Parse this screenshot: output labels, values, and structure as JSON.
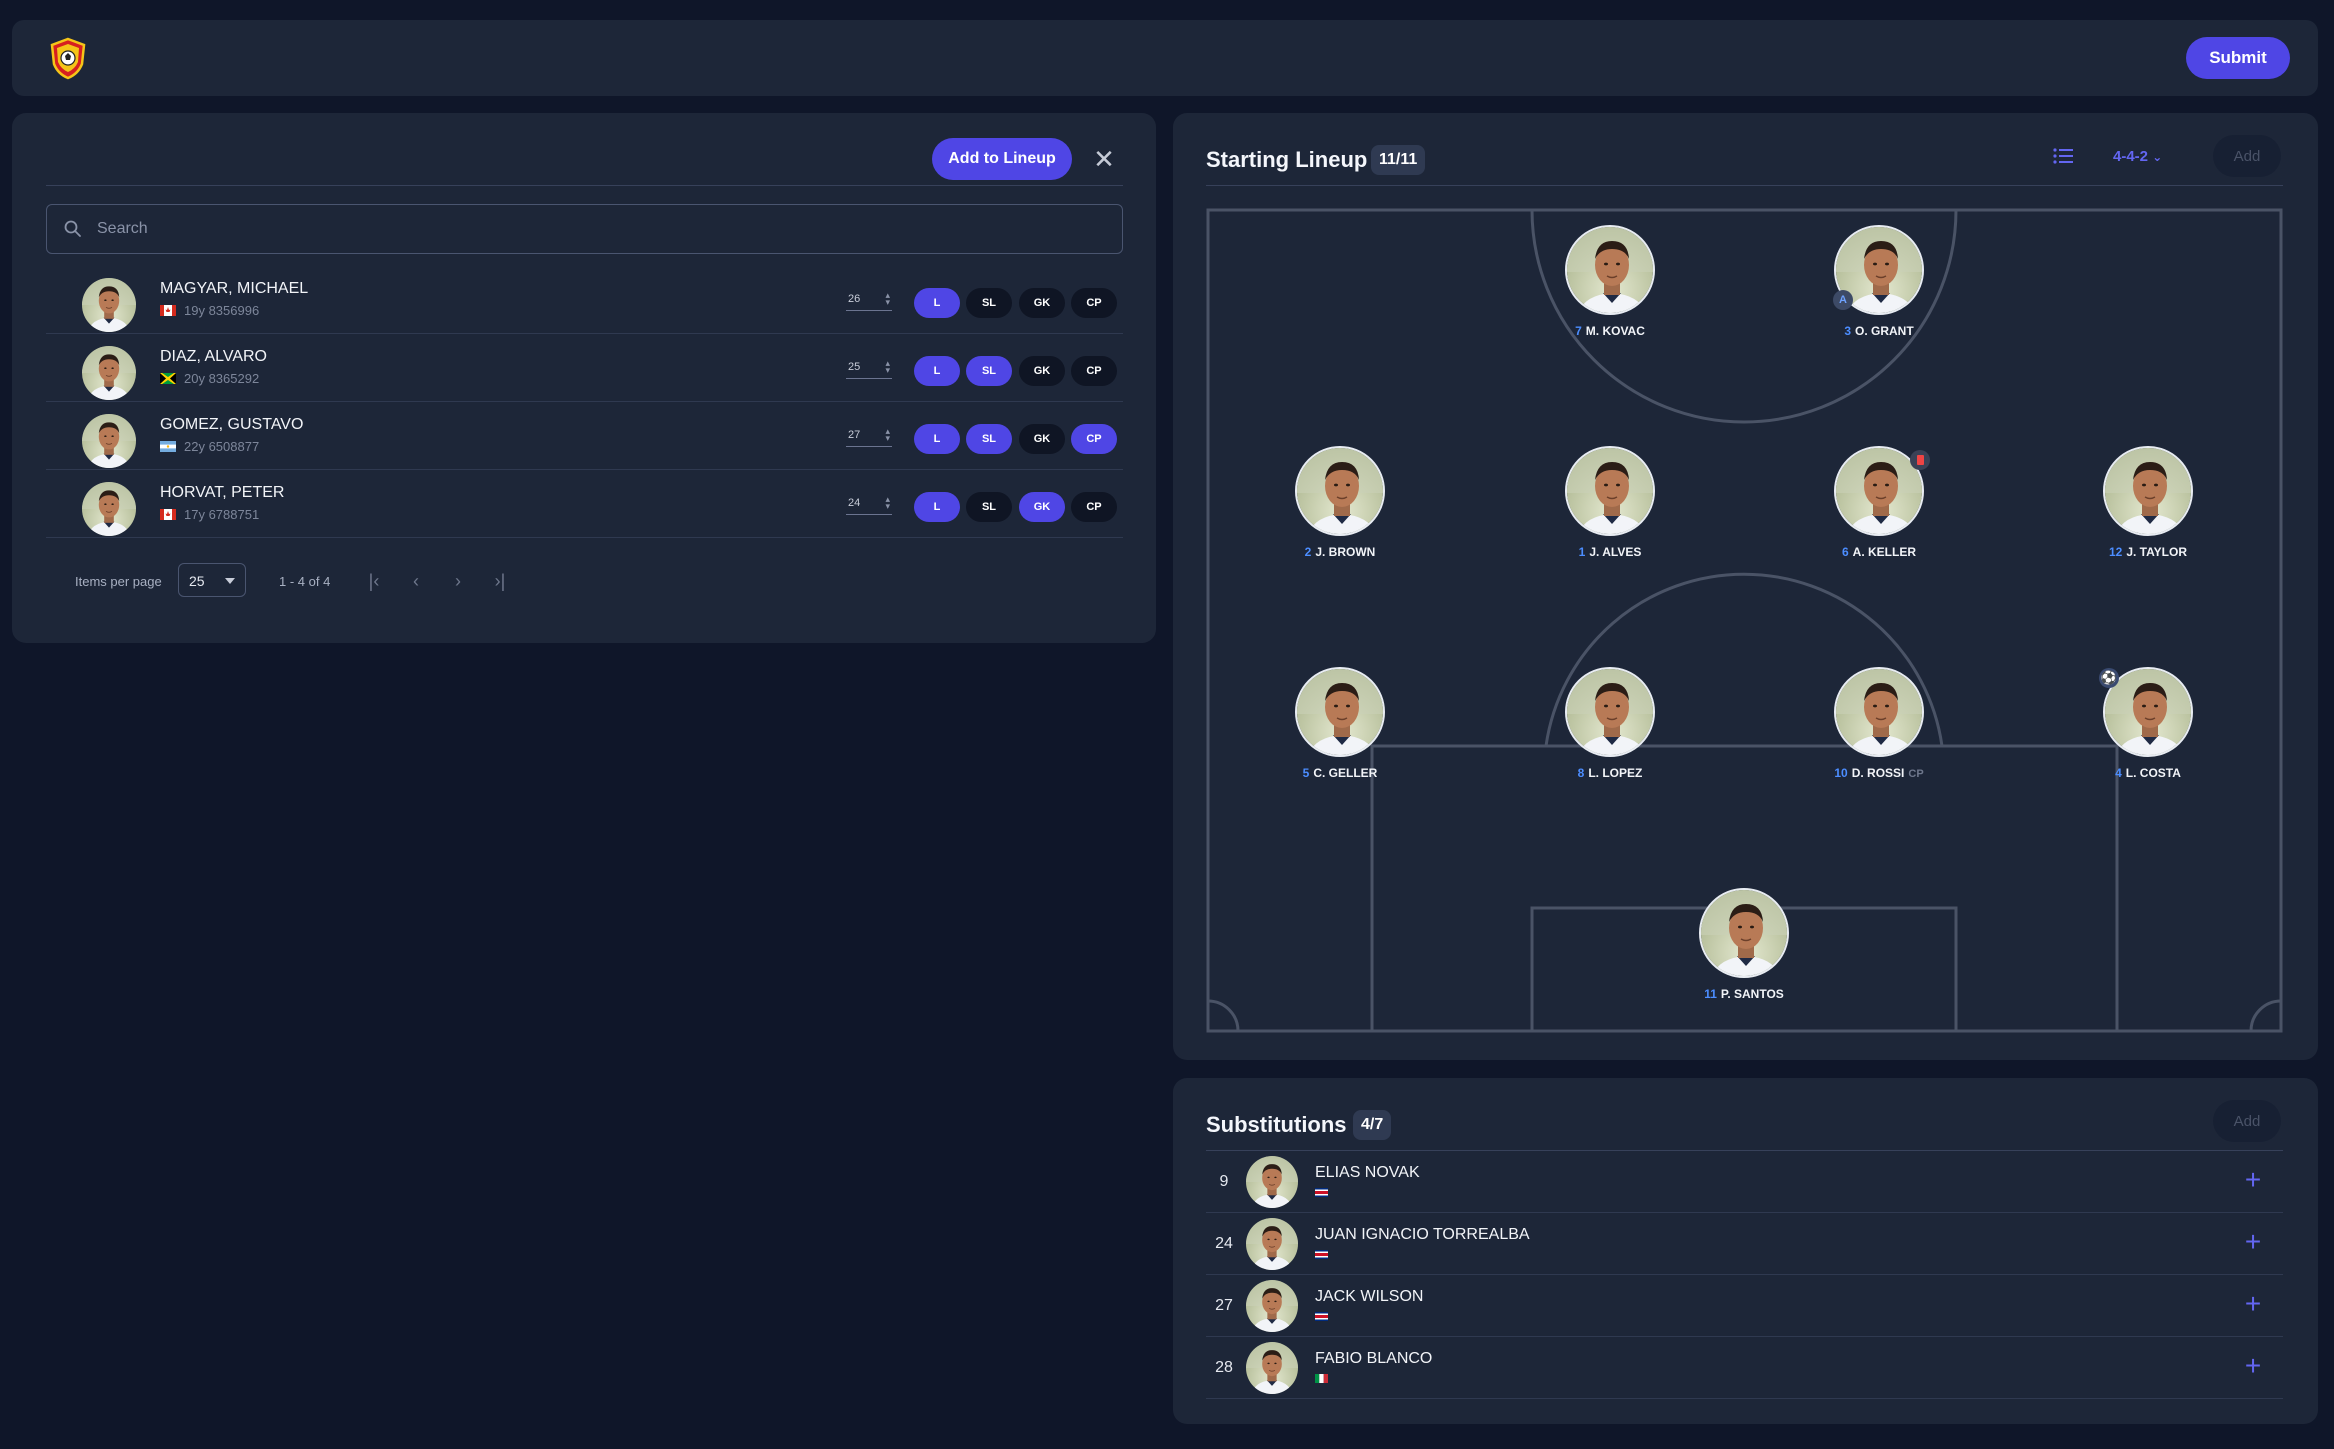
{
  "header": {
    "submit_label": "Submit"
  },
  "search_panel": {
    "add_label": "Add to Lineup",
    "close_icon": "close-icon",
    "search_placeholder": "Search",
    "players": [
      {
        "name": "MAGYAR, MICHAEL",
        "meta": "19y 8356996",
        "flag": "canada",
        "number": "26",
        "active": [
          "L"
        ]
      },
      {
        "name": "DIAZ, ALVARO",
        "meta": "20y 8365292",
        "flag": "jamaica",
        "number": "25",
        "active": [
          "L",
          "SL"
        ]
      },
      {
        "name": "GOMEZ, GUSTAVO",
        "meta": "22y 6508877",
        "flag": "argentina",
        "number": "27",
        "active": [
          "L",
          "SL",
          "CP"
        ]
      },
      {
        "name": "HORVAT, PETER",
        "meta": "17y 6788751",
        "flag": "canada",
        "number": "24",
        "active": [
          "L",
          "GK"
        ]
      }
    ],
    "toggles": [
      "L",
      "SL",
      "GK",
      "CP"
    ],
    "pager": {
      "items_label": "Items per page",
      "per_page": "25",
      "range": "1 - 4 of 4"
    }
  },
  "lineup": {
    "title": "Starting Lineup",
    "count": "11/11",
    "formation": "4-4-2",
    "add_label": "Add",
    "players": [
      {
        "number": "7",
        "name": "M. KOVAC"
      },
      {
        "number": "3",
        "name": "O. GRANT",
        "badge": "A"
      },
      {
        "number": "2",
        "name": "J. BROWN"
      },
      {
        "number": "1",
        "name": "J. ALVES"
      },
      {
        "number": "6",
        "name": "A. KELLER"
      },
      {
        "number": "12",
        "name": "J. TAYLOR"
      },
      {
        "number": "5",
        "name": "C. GELLER"
      },
      {
        "number": "8",
        "name": "L. LOPEZ"
      },
      {
        "number": "10",
        "name": "D. ROSSI",
        "tag": "CP"
      },
      {
        "number": "4",
        "name": "L. COSTA"
      },
      {
        "number": "11",
        "name": "P. SANTOS"
      }
    ]
  },
  "substitutions": {
    "title": "Substitutions",
    "count": "4/7",
    "add_label": "Add",
    "players": [
      {
        "number": "9",
        "name": "ELIAS NOVAK",
        "flag": "costa-rica"
      },
      {
        "number": "24",
        "name": "JUAN IGNACIO TORREALBA",
        "flag": "costa-rica"
      },
      {
        "number": "27",
        "name": "JACK WILSON",
        "flag": "costa-rica"
      },
      {
        "number": "28",
        "name": "FABIO BLANCO",
        "flag": "italy"
      }
    ]
  },
  "colors": {
    "accent": "#4f46e5",
    "background": "#0f1629",
    "panel": "#1d2638",
    "number_blue": "#4c8dff"
  }
}
